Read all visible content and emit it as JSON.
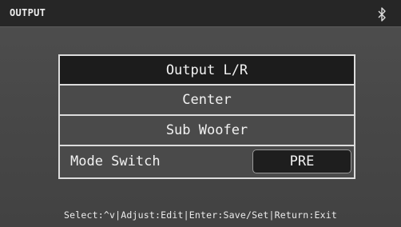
{
  "header": {
    "title": "OUTPUT",
    "bluetooth_icon": "bluetooth-icon"
  },
  "menu": {
    "items": [
      {
        "label": "Output L/R",
        "selected": true
      },
      {
        "label": "Center",
        "selected": false
      },
      {
        "label": "Sub Woofer",
        "selected": false
      }
    ],
    "mode_switch": {
      "label": "Mode Switch",
      "value": "PRE"
    }
  },
  "footer": {
    "help": "Select:^v|Adjust:Edit|Enter:Save/Set|Return:Exit"
  },
  "colors": {
    "background": "#474747",
    "titlebar": "#262626",
    "selected_row": "#1c1c1c",
    "border": "#dcdcdc",
    "text": "#f2f2f2"
  }
}
